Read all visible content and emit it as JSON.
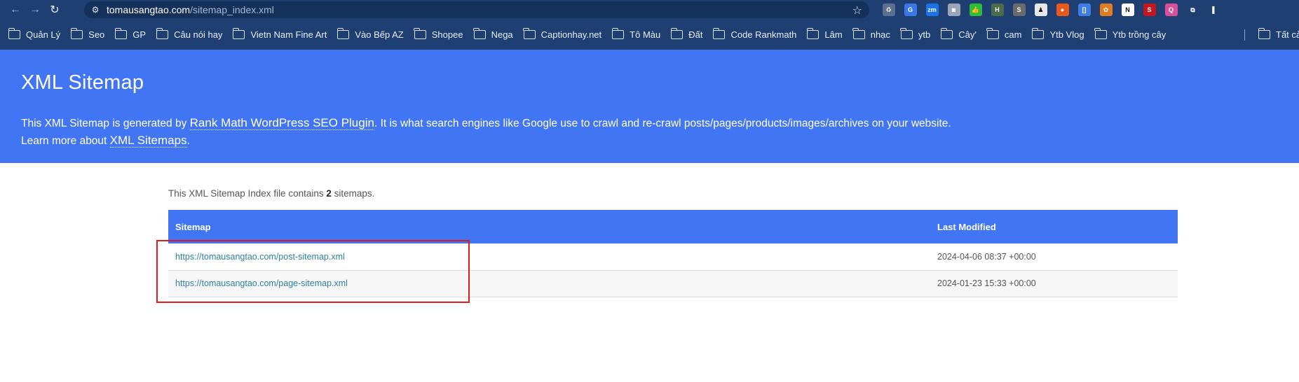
{
  "browser": {
    "url_host": "tomausangtao.com",
    "url_path": "/sitemap_index.xml",
    "bookmarks": [
      "Quản Lý",
      "Seo",
      "GP",
      "Câu nói hay",
      "Vietn Nam Fine Art",
      "Vào Bếp AZ",
      "Shopee",
      "Nega",
      "Captionhay.net",
      "Tô Màu",
      "Đất",
      "Code Rankmath",
      "Lâm",
      "nhạc",
      "ytb",
      "Cây'",
      "cam",
      "Ytb Vlog",
      "Ytb trồng cây"
    ],
    "bookmark_right": "Tất cả",
    "extensions": [
      {
        "name": "recycle-extension-icon",
        "color": "#5b6f8f",
        "label": "♻"
      },
      {
        "name": "translate-extension-icon",
        "color": "#3b78e7",
        "label": "G"
      },
      {
        "name": "zm-extension-icon",
        "color": "#1a73e8",
        "label": "zm"
      },
      {
        "name": "camera-extension-icon",
        "color": "#9aa6b8",
        "label": "◙"
      },
      {
        "name": "thumbs-up-extension-icon",
        "color": "#2ebd3b",
        "label": "👍"
      },
      {
        "name": "heading-extension-icon",
        "color": "#4b6b4b",
        "label": "H"
      },
      {
        "name": "s-grey-extension-icon",
        "color": "#6b6b6b",
        "label": "S"
      },
      {
        "name": "person-extension-icon",
        "color": "#e8e8e8",
        "label": "♟"
      },
      {
        "name": "fox-extension-icon",
        "color": "#e8591a",
        "label": "●"
      },
      {
        "name": "bracket-extension-icon",
        "color": "#3d7de6",
        "label": "[]"
      },
      {
        "name": "maple-extension-icon",
        "color": "#e37b1f",
        "label": "✿"
      },
      {
        "name": "notion-extension-icon",
        "color": "#ffffff",
        "label": "N"
      },
      {
        "name": "s-red-extension-icon",
        "color": "#c4161c",
        "label": "S"
      },
      {
        "name": "search-pink-extension-icon",
        "color": "#d94f9a",
        "label": "Q"
      },
      {
        "name": "puzzle-extension-icon",
        "color": "#1f3f73",
        "label": "⧉"
      },
      {
        "name": "sidebar-extension-icon",
        "color": "#1f3f73",
        "label": "▌"
      }
    ]
  },
  "header": {
    "title": "XML Sitemap",
    "desc_pre": "This XML Sitemap is generated by ",
    "desc_link": "Rank Math WordPress SEO Plugin",
    "desc_post": ". It is what search engines like Google use to crawl and re-crawl posts/pages/products/images/archives on your website.",
    "learn_pre": "Learn more about ",
    "learn_link": "XML Sitemaps",
    "learn_post": "."
  },
  "summary": {
    "pre": "This XML Sitemap Index file contains ",
    "count": "2",
    "post": " sitemaps."
  },
  "table": {
    "headers": [
      "Sitemap",
      "Last Modified"
    ],
    "rows": [
      {
        "url": "https://tomausangtao.com/post-sitemap.xml",
        "modified": "2024-04-06 08:37 +00:00"
      },
      {
        "url": "https://tomausangtao.com/page-sitemap.xml",
        "modified": "2024-01-23 15:33 +00:00"
      }
    ]
  },
  "colors": {
    "brand_blue": "#4275f4",
    "chrome": "#1f3f73",
    "highlight": "#e01b1b",
    "link": "#2e7fa0"
  }
}
